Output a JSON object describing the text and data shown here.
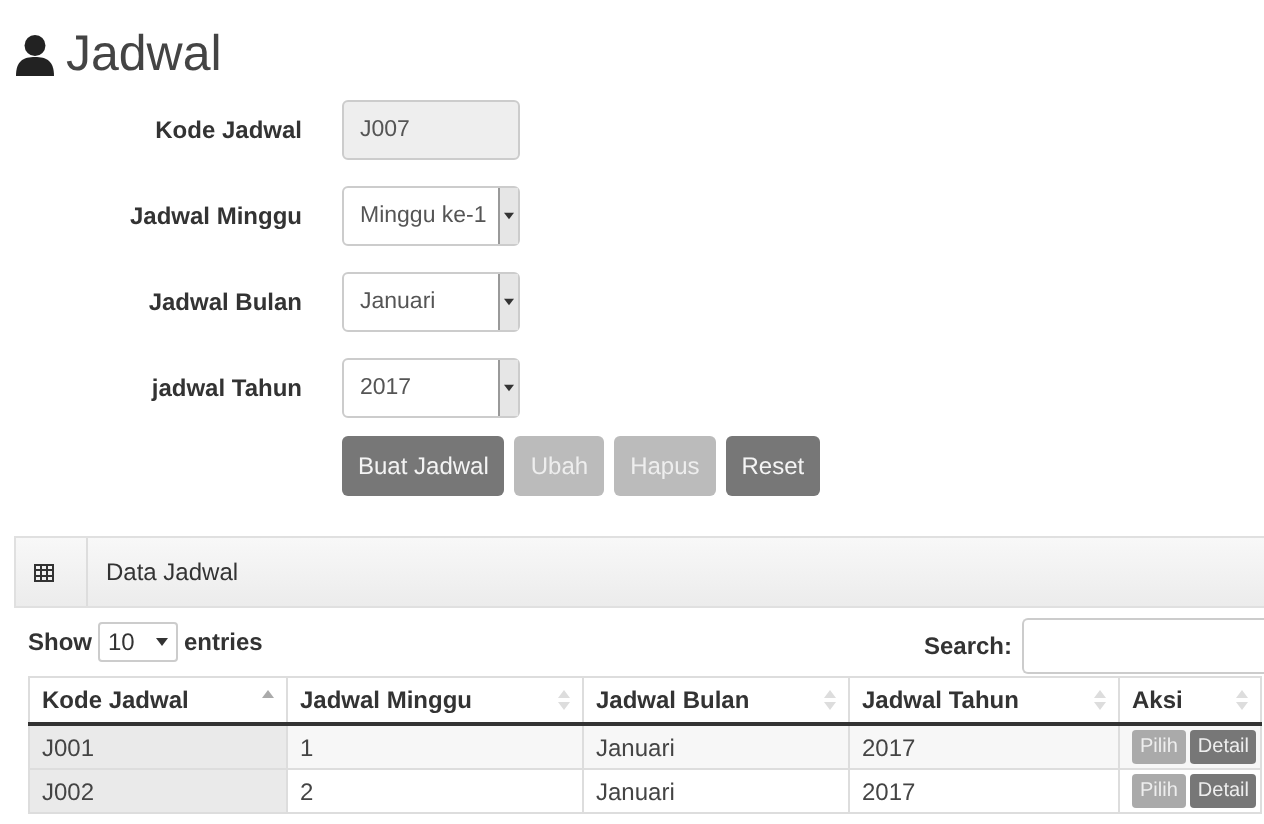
{
  "title": "Jadwal",
  "form": [
    {
      "label": "Kode Jadwal",
      "kind": "text",
      "value": "J007",
      "disabled": true
    },
    {
      "label": "Jadwal Minggu",
      "kind": "select",
      "value": "Minggu ke-1",
      "disabled": false
    },
    {
      "label": "Jadwal Bulan",
      "kind": "select",
      "value": "Januari",
      "disabled": false
    },
    {
      "label": "jadwal Tahun",
      "kind": "select",
      "value": "2017",
      "disabled": false
    }
  ],
  "buttons": [
    {
      "label": "Buat Jadwal",
      "disabled": false
    },
    {
      "label": "Ubah",
      "disabled": true
    },
    {
      "label": "Hapus",
      "disabled": true
    },
    {
      "label": "Reset",
      "disabled": false
    }
  ],
  "panel": {
    "title": "Data Jadwal",
    "length": {
      "before": "Show",
      "value": "10",
      "after": "entries"
    },
    "search": {
      "label": "Search:"
    },
    "table": {
      "columns": [
        {
          "label": "Kode Jadwal",
          "sorted": true
        },
        {
          "label": "Jadwal Minggu",
          "sorted": false
        },
        {
          "label": "Jadwal Bulan",
          "sorted": false
        },
        {
          "label": "Jadwal Tahun",
          "sorted": false
        },
        {
          "label": "Aksi",
          "sorted": false
        }
      ],
      "rows": [
        {
          "cells": [
            "J001",
            "1",
            "Januari",
            "2017"
          ],
          "actions": [
            {
              "label": "Pilih",
              "disabled": true
            },
            {
              "label": "Detail",
              "disabled": false
            }
          ]
        },
        {
          "cells": [
            "J002",
            "2",
            "Januari",
            "2017"
          ],
          "actions": [
            {
              "label": "Pilih",
              "disabled": true
            },
            {
              "label": "Detail",
              "disabled": false
            }
          ]
        }
      ]
    }
  }
}
